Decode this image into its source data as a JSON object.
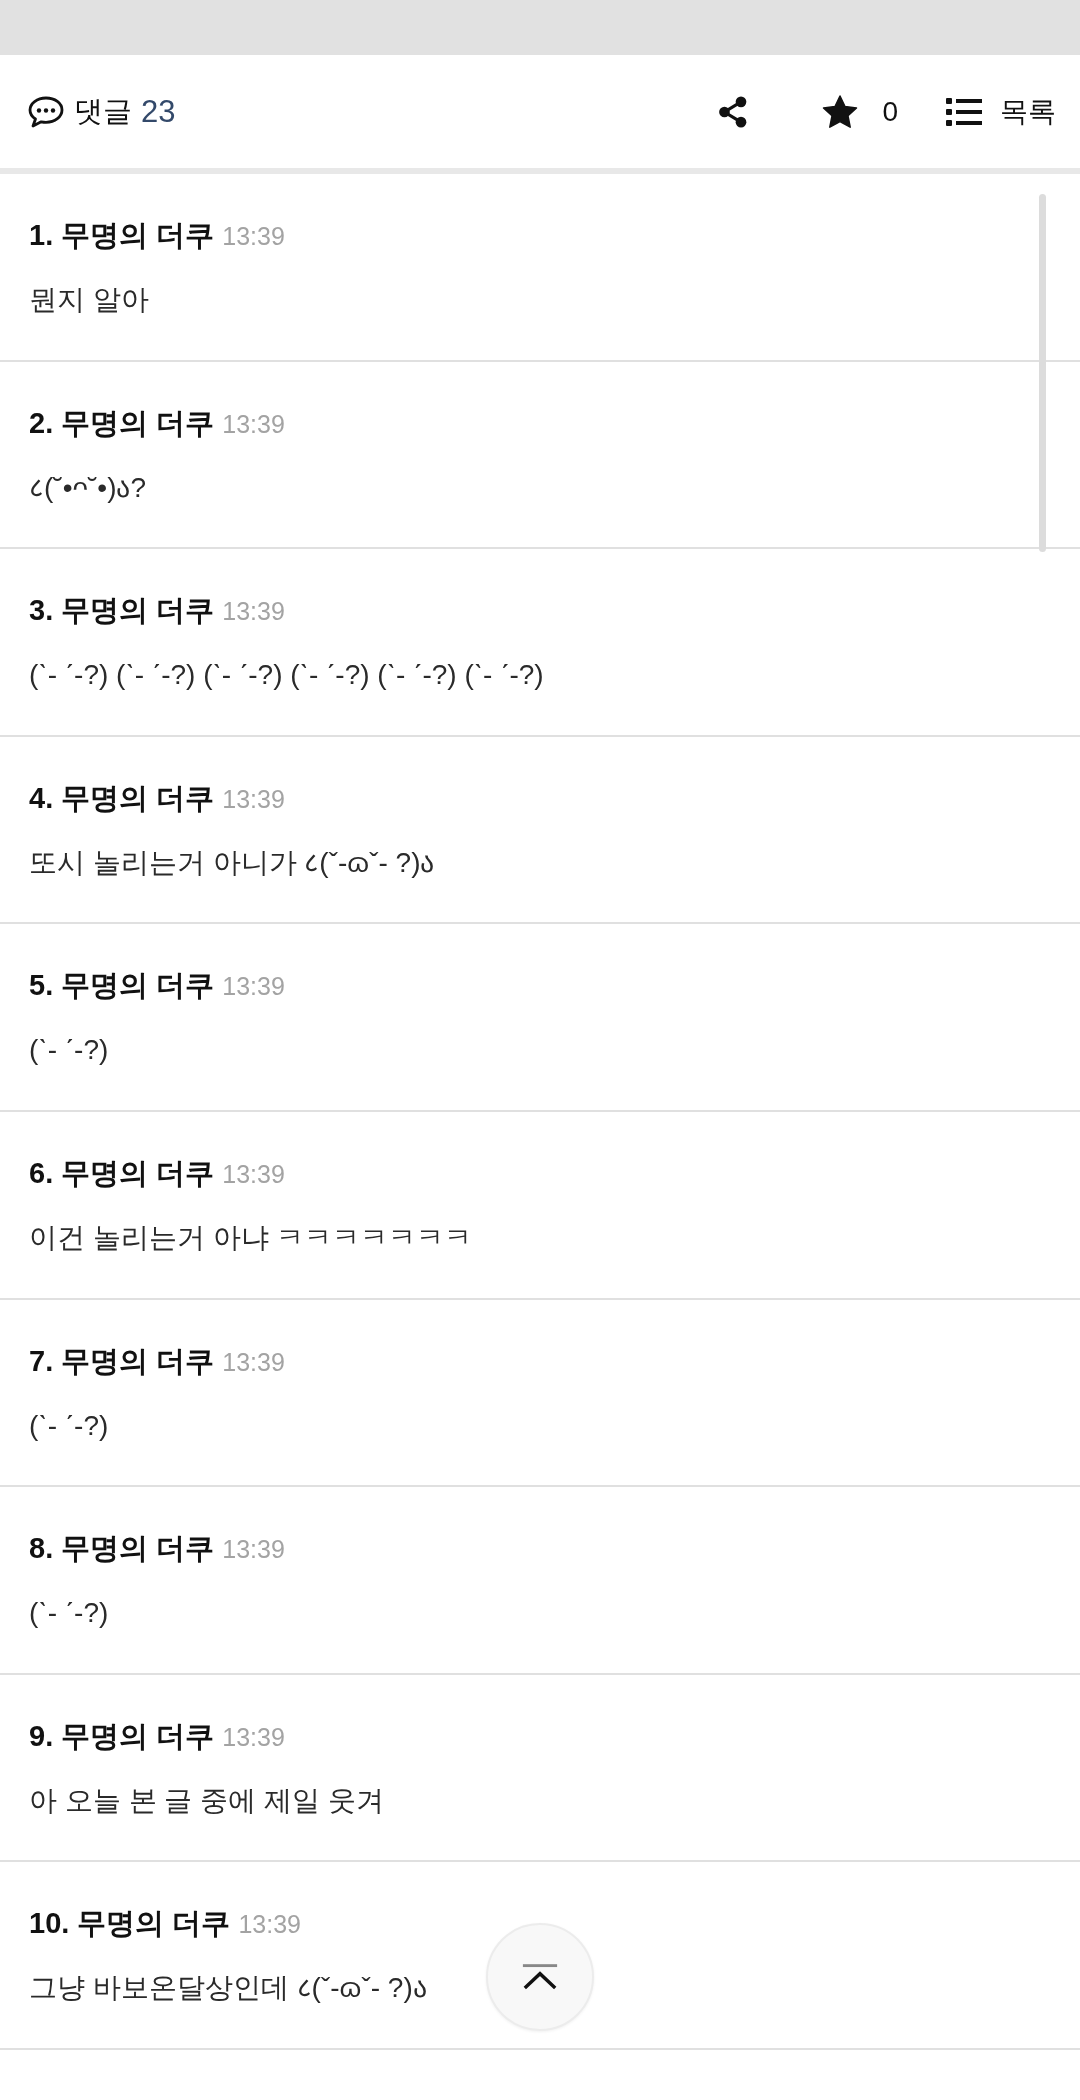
{
  "header": {
    "comments_label": "댓글",
    "comment_count": "23",
    "star_count": "0",
    "list_label": "목록"
  },
  "comments": [
    {
      "heading": "1. 무명의 더쿠",
      "time": "13:39",
      "body": "뭔지 알아"
    },
    {
      "heading": "2. 무명의 더쿠",
      "time": "13:39",
      "body": "८(˘•ᴖ˘•)ა?"
    },
    {
      "heading": "3. 무명의 더쿠",
      "time": "13:39",
      "body": "(ˋ- ˊ-?) (ˋ- ˊ-?) (ˋ- ˊ-?) (ˋ- ˊ-?) (ˋ- ˊ-?) (ˋ- ˊ-?)"
    },
    {
      "heading": "4. 무명의 더쿠",
      "time": "13:39",
      "body": "또시 놀리는거 아니가 ८(ˇ-ɷˇ- ?)ა"
    },
    {
      "heading": "5. 무명의 더쿠",
      "time": "13:39",
      "body": "(ˋ- ˊ-?)"
    },
    {
      "heading": "6. 무명의 더쿠",
      "time": "13:39",
      "body": "이건 놀리는거 아냐 ㅋㅋㅋㅋㅋㅋㅋ"
    },
    {
      "heading": "7. 무명의 더쿠",
      "time": "13:39",
      "body": "(ˋ- ˊ-?)"
    },
    {
      "heading": "8. 무명의 더쿠",
      "time": "13:39",
      "body": "(ˋ- ˊ-?)"
    },
    {
      "heading": "9. 무명의 더쿠",
      "time": "13:39",
      "body": "아 오늘 본 글 중에 제일 웃겨"
    },
    {
      "heading": "10. 무명의 더쿠",
      "time": "13:39",
      "body": "그냥 바보온달상인데 ८(ˇ-ɷˇ- ?)ა"
    }
  ]
}
